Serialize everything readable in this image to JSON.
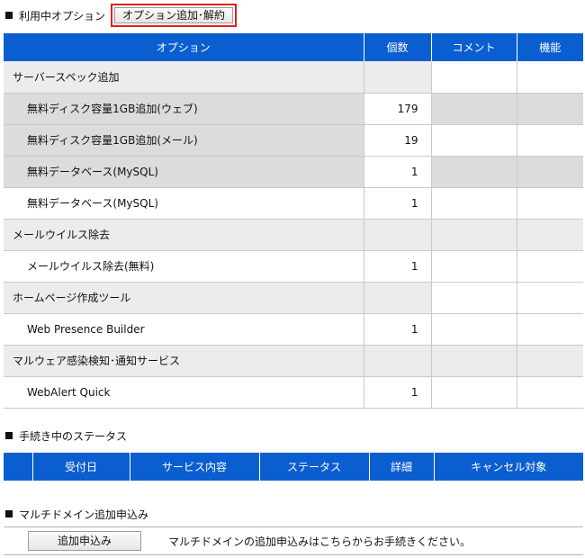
{
  "options_section": {
    "title": "利用中オプション",
    "add_cancel_button": "オプション追加･解約",
    "columns": [
      "オプション",
      "個数",
      "コメント",
      "機能"
    ],
    "rows": [
      {
        "type": "category",
        "name": "サーバースペック追加",
        "count": ""
      },
      {
        "type": "item",
        "name": "無料ディスク容量1GB追加(ウェブ)",
        "count": "179"
      },
      {
        "type": "item",
        "name": "無料ディスク容量1GB追加(メール)",
        "count": "19"
      },
      {
        "type": "item",
        "name": "無料データベース(MySQL)",
        "count": "1"
      },
      {
        "type": "item",
        "name": "無料データベース(MySQL)",
        "count": "1"
      },
      {
        "type": "category",
        "name": "メールウイルス除去",
        "count": ""
      },
      {
        "type": "item_white",
        "name": "メールウイルス除去(無料)",
        "count": "1"
      },
      {
        "type": "category",
        "name": "ホームページ作成ツール",
        "count": ""
      },
      {
        "type": "item_white",
        "name": "Web Presence Builder",
        "count": "1"
      },
      {
        "type": "category",
        "name": "マルウェア感染検知･通知サービス",
        "count": ""
      },
      {
        "type": "item_white",
        "name": "WebAlert Quick",
        "count": "1"
      }
    ]
  },
  "status_section": {
    "title": "手続き中のステータス",
    "columns": [
      "受付日",
      "サービス内容",
      "ステータス",
      "詳細",
      "キャンセル対象"
    ]
  },
  "multidomain_section": {
    "title": "マルチドメイン追加申込み",
    "apply_button": "追加申込み",
    "description": "マルチドメインの追加申込みはこちらからお手続きください。"
  },
  "colors": {
    "header_blue": "#0b5ed0",
    "highlight_red": "#e02020",
    "category_gray": "#ececec",
    "item_gray": "#dcdcdc"
  }
}
